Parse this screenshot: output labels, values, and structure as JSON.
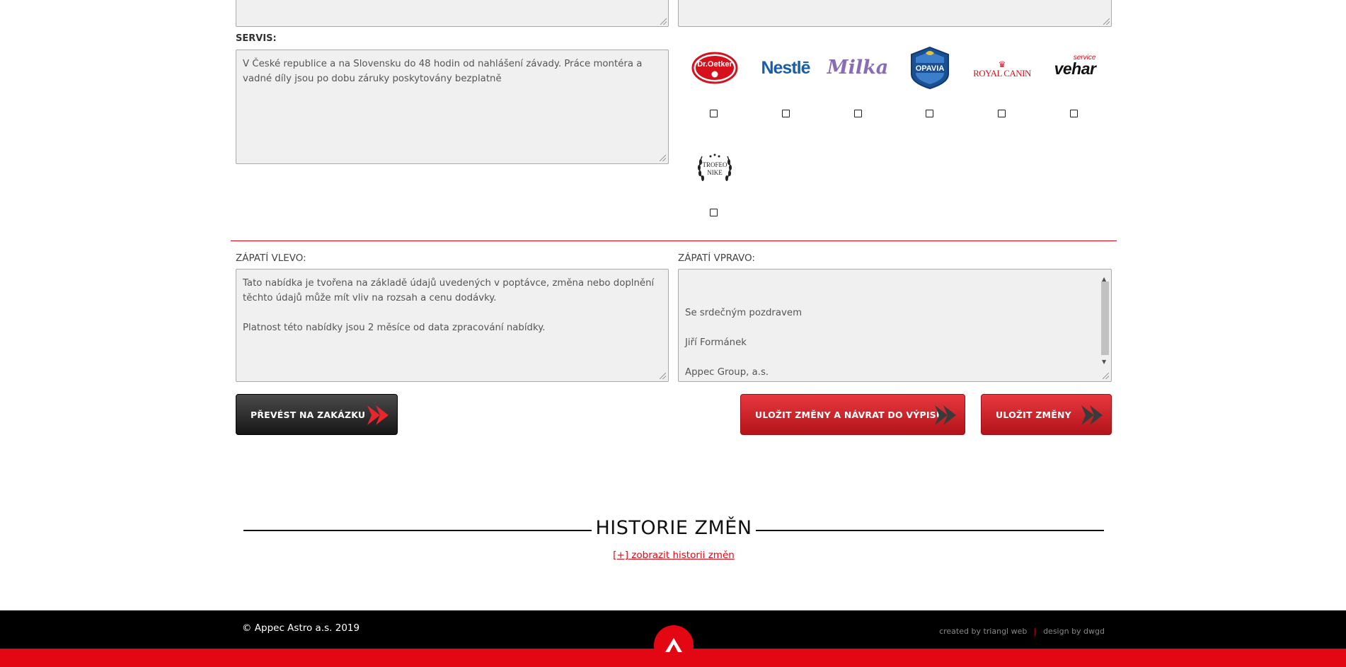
{
  "form": {
    "servis_label": "SERVIS:",
    "servis_text": "V České republice a na Slovensku do 48 hodin od nahlášení závady. Práce montéra a vadné díly jsou po dobu záruky poskytovány bezplatně",
    "footer_left_label": "ZÁPATÍ VLEVO:",
    "footer_left_text": "Tato nabídka je tvořena na základě údajů uvedených v poptávce, změna nebo doplnění těchto údajů může mít vliv na rozsah a cenu dodávky.\n\nPlatnost této nabídky jsou 2 měsíce od data zpracování nabídky.",
    "footer_right_label": "ZÁPATÍ VPRAVO:",
    "footer_right_text": "Se srdečným pozdravem\n\nJiří Formánek\n\nAppec Group, a.s.\nTel.:\njiri.formanek@appecastro.cz"
  },
  "logos": [
    {
      "name": "Dr.Oetker",
      "checked": false
    },
    {
      "name": "Nestlé",
      "checked": false
    },
    {
      "name": "Milka",
      "checked": false
    },
    {
      "name": "OPAVIA",
      "checked": false
    },
    {
      "name": "ROYAL CANIN",
      "checked": false
    },
    {
      "name": "vehar",
      "checked": false
    },
    {
      "name": "TROFEO NIKE",
      "checked": false
    }
  ],
  "logo_text": {
    "dr_oetker": "Dr.Oetker",
    "nestle": "Nestlē",
    "milka": "Milka",
    "opavia": "OPAVIA",
    "royal_canin": "ROYAL CANIN",
    "vehar": "vehar",
    "vehar_service": "service",
    "trofeo_1": "TROFEO",
    "trofeo_2": "NIKE"
  },
  "buttons": {
    "convert": "PŘEVÉST NA ZAKÁZKU",
    "save_return": "ULOŽIT ZMĚNY A NÁVRAT DO VÝPISU",
    "save": "ULOŽIT ZMĚNY"
  },
  "history": {
    "title": "HISTORIE ZMĚN",
    "link": "[+] zobrazit historii změn"
  },
  "footer": {
    "copyright": "© Appec Astro a.s. 2019",
    "created_by": "created by triangl web",
    "separator": "|",
    "design_by": "design by dwgd"
  },
  "colors": {
    "accent_red": "#e30613",
    "footer_bg": "#000000"
  }
}
